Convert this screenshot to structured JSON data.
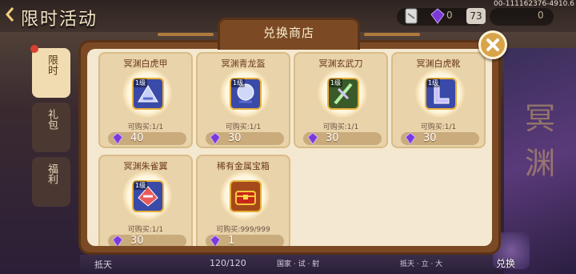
{
  "header": {
    "title": "限时活动",
    "resource_value": "73",
    "resource_value_right": "0",
    "resource_value_left": "0",
    "user_id": "00-111162376-4910.6"
  },
  "side_tabs": [
    {
      "label": "限时"
    },
    {
      "label": "礼包"
    },
    {
      "label": "福利"
    }
  ],
  "background": {
    "right_deco": "冥渊",
    "bottom_texts": [
      "抵天",
      "120/120",
      "国家 · 试 · 射",
      "抵天 · 立 · 大",
      "兑换"
    ]
  },
  "modal": {
    "title": "兑换商店",
    "items": [
      {
        "name": "冥渊白虎甲",
        "level": "1级",
        "limit": "可购买:1/1",
        "price": "40"
      },
      {
        "name": "冥渊青龙盔",
        "level": "1级",
        "limit": "可购买:1/1",
        "price": "30"
      },
      {
        "name": "冥渊玄武刀",
        "level": "1级",
        "limit": "可购买:1/1",
        "price": "30"
      },
      {
        "name": "冥渊白虎靴",
        "level": "1级",
        "limit": "可购买:1/1",
        "price": "30"
      },
      {
        "name": "冥渊朱雀翼",
        "level": "1级",
        "limit": "可购买:1/1",
        "price": "30"
      },
      {
        "name": "稀有金属宝箱",
        "level": "",
        "limit": "可购买:999/999",
        "price": "1"
      }
    ]
  },
  "colors": {
    "modal_frame": "#7b4a24",
    "modal_bg": "#f4e8d0",
    "card_bg": "#e9d3aa",
    "price_bar": "#c9ab7c",
    "gem": "#7a3ad8"
  },
  "icons": [
    "back-arrow-icon",
    "card-icon",
    "purple-gem-icon",
    "close-icon",
    "equipment-icon",
    "treasure-chest-icon"
  ]
}
